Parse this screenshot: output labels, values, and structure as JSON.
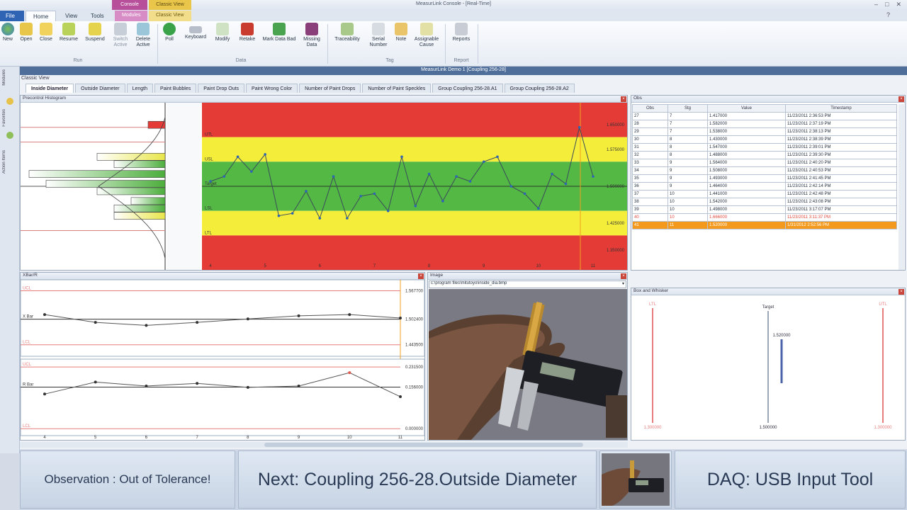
{
  "window": {
    "title": "MeasurLink Console - [Real-Time]"
  },
  "context_tabs": {
    "console": "Console",
    "console_modules": "Modules",
    "classic": "Classic View",
    "classic_sub": "Classic View"
  },
  "ribbon_tabs": [
    "File",
    "Home",
    "View",
    "Tools"
  ],
  "ribbon": {
    "run": {
      "label": "Run",
      "buttons": [
        "New",
        "Open",
        "Close",
        "Resume",
        "Suspend",
        "Switch Active",
        "Delete Active"
      ]
    },
    "data": {
      "label": "Data",
      "buttons": [
        "Poll",
        "Keyboard",
        "Modify",
        "Retake",
        "Mark Data Bad",
        "Missing Data"
      ]
    },
    "tag": {
      "label": "Tag",
      "buttons": [
        "Traceability",
        "Serial Number",
        "Note",
        "Assignable Cause"
      ]
    },
    "report": {
      "label": "Report",
      "buttons": [
        "Reports"
      ]
    }
  },
  "doc_title": "MeasurLink Demo 1 [Coupling 256-28]",
  "classic_view": "Classic View",
  "side_items": [
    "Modules",
    "Favorites",
    "Action Items"
  ],
  "chart_tabs": [
    "Inside Diameter",
    "Outside Diameter",
    "Length",
    "Paint Bubbles",
    "Paint Drop Outs",
    "Paint Wrong Color",
    "Number of Paint Drops",
    "Number of Paint Speckles",
    "Group Coupling 256-28.A1",
    "Group Coupling 256-28.A2"
  ],
  "panes": {
    "histogram": "Precontrol Histogram",
    "xbar": "XBar/R",
    "image": "Image",
    "obs": "Obs",
    "box": "Box and Whisker"
  },
  "image_path": "c:\\program files\\mitutoyo\\inside_dia.bmp",
  "limit_labels": {
    "utl": "UTL",
    "usl": "USL",
    "target": "Target",
    "lsl": "LSL",
    "ltl": "LTL",
    "ucl": "UCL",
    "lcl": "LCL",
    "xbar": "X Bar",
    "rbar": "R Bar"
  },
  "value_labels": {
    "top": "1.650000",
    "usl": "1.575000",
    "target": "1.500000",
    "lsl": "1.425000",
    "bottom": "1.350000"
  },
  "xbar_values": {
    "ucl": "1.567700",
    "center": "1.502400",
    "lcl": "1.443500",
    "r_ucl": "0.231500",
    "r_center": "0.156000",
    "r_lcl": "0.000000"
  },
  "box": {
    "ltl_label": "1.300000",
    "target_label": "1.500000",
    "utl_label": "1.300000",
    "value_label": "1.520000",
    "ltl": "LTL",
    "target": "Target",
    "utl": "UTL"
  },
  "obs_table": {
    "headers": [
      "Obs",
      "Stg",
      "Value",
      "Timestamp"
    ],
    "rows": [
      [
        "27",
        "7",
        "1.417000",
        "11/23/2011 2:36:53 PM"
      ],
      [
        "28",
        "7",
        "1.582000",
        "11/23/2011 2:37:19 PM"
      ],
      [
        "29",
        "7",
        "1.538000",
        "11/23/2011 2:38:13 PM"
      ],
      [
        "30",
        "8",
        "1.430000",
        "11/23/2011 2:38:39 PM"
      ],
      [
        "31",
        "8",
        "1.547000",
        "11/23/2011 2:39:01 PM"
      ],
      [
        "32",
        "8",
        "1.488000",
        "11/23/2011 2:39:30 PM"
      ],
      [
        "33",
        "9",
        "1.564000",
        "11/23/2011 2:40:20 PM"
      ],
      [
        "34",
        "9",
        "1.508000",
        "11/23/2011 2:40:53 PM"
      ],
      [
        "35",
        "9",
        "1.493000",
        "11/23/2011 2:41:45 PM"
      ],
      [
        "36",
        "9",
        "1.464000",
        "11/23/2011 2:42:14 PM"
      ],
      [
        "37",
        "10",
        "1.441000",
        "11/23/2011 2:42:48 PM"
      ],
      [
        "38",
        "10",
        "1.542000",
        "11/23/2011 2:43:08 PM"
      ],
      [
        "39",
        "10",
        "1.498000",
        "11/23/2011 3:17:07 PM"
      ],
      [
        "40",
        "10",
        "1.666000",
        "11/23/2011 3:11:37 PM"
      ],
      [
        "41",
        "11",
        "1.520000",
        "1/31/2012 2:52:56 PM"
      ]
    ]
  },
  "status": {
    "observation": "Observation : Out of Tolerance!",
    "next": "Next: Coupling 256-28.Outside Diameter",
    "daq": "DAQ: USB Input Tool"
  },
  "colors": {
    "red": "#e53b37",
    "yellow": "#f4ee3b",
    "green": "#53b844",
    "accent": "#2f64b5",
    "selected": "#f39a1e"
  },
  "chart_data": [
    {
      "type": "line",
      "name": "Precontrol chart",
      "x": [
        4,
        5,
        6,
        7,
        8,
        9,
        10,
        11
      ],
      "x_ticks": [
        "4",
        "5",
        "6",
        "7",
        "8",
        "9",
        "10",
        "11"
      ],
      "ylim": [
        1.33,
        1.67
      ],
      "zones": {
        "red_high": [
          1.6,
          1.67
        ],
        "yellow_high": [
          1.55,
          1.6
        ],
        "green": [
          1.45,
          1.55
        ],
        "yellow_low": [
          1.4,
          1.45
        ],
        "red_low": [
          1.33,
          1.4
        ]
      },
      "values": [
        1.51,
        1.52,
        1.56,
        1.53,
        1.565,
        1.44,
        1.445,
        1.49,
        1.435,
        1.52,
        1.435,
        1.48,
        1.485,
        1.45,
        1.56,
        1.46,
        1.525,
        1.47,
        1.52,
        1.51,
        1.55,
        1.56,
        1.5,
        1.485,
        1.455,
        1.525,
        1.505,
        1.62,
        1.52
      ]
    },
    {
      "type": "line",
      "name": "XBar",
      "x": [
        4,
        5,
        6,
        7,
        8,
        9,
        10,
        11
      ],
      "values": [
        1.513,
        1.495,
        1.488,
        1.495,
        1.503,
        1.51,
        1.513,
        1.505
      ],
      "ucl": 1.5677,
      "center": 1.5024,
      "lcl": 1.4435
    },
    {
      "type": "line",
      "name": "Range",
      "x": [
        4,
        5,
        6,
        7,
        8,
        9,
        10,
        11
      ],
      "values": [
        0.13,
        0.175,
        0.16,
        0.17,
        0.155,
        0.16,
        0.21,
        0.12
      ],
      "ucl": 0.2315,
      "center": 0.156,
      "lcl": 0.0
    },
    {
      "type": "bar",
      "name": "Precontrol Histogram",
      "orientation": "horizontal",
      "bins": [
        1.625,
        1.56,
        1.545,
        1.525,
        1.505,
        1.49,
        1.47,
        1.455,
        1.44
      ],
      "counts": [
        1,
        4,
        3,
        8,
        7,
        4,
        2,
        3,
        3
      ]
    }
  ]
}
